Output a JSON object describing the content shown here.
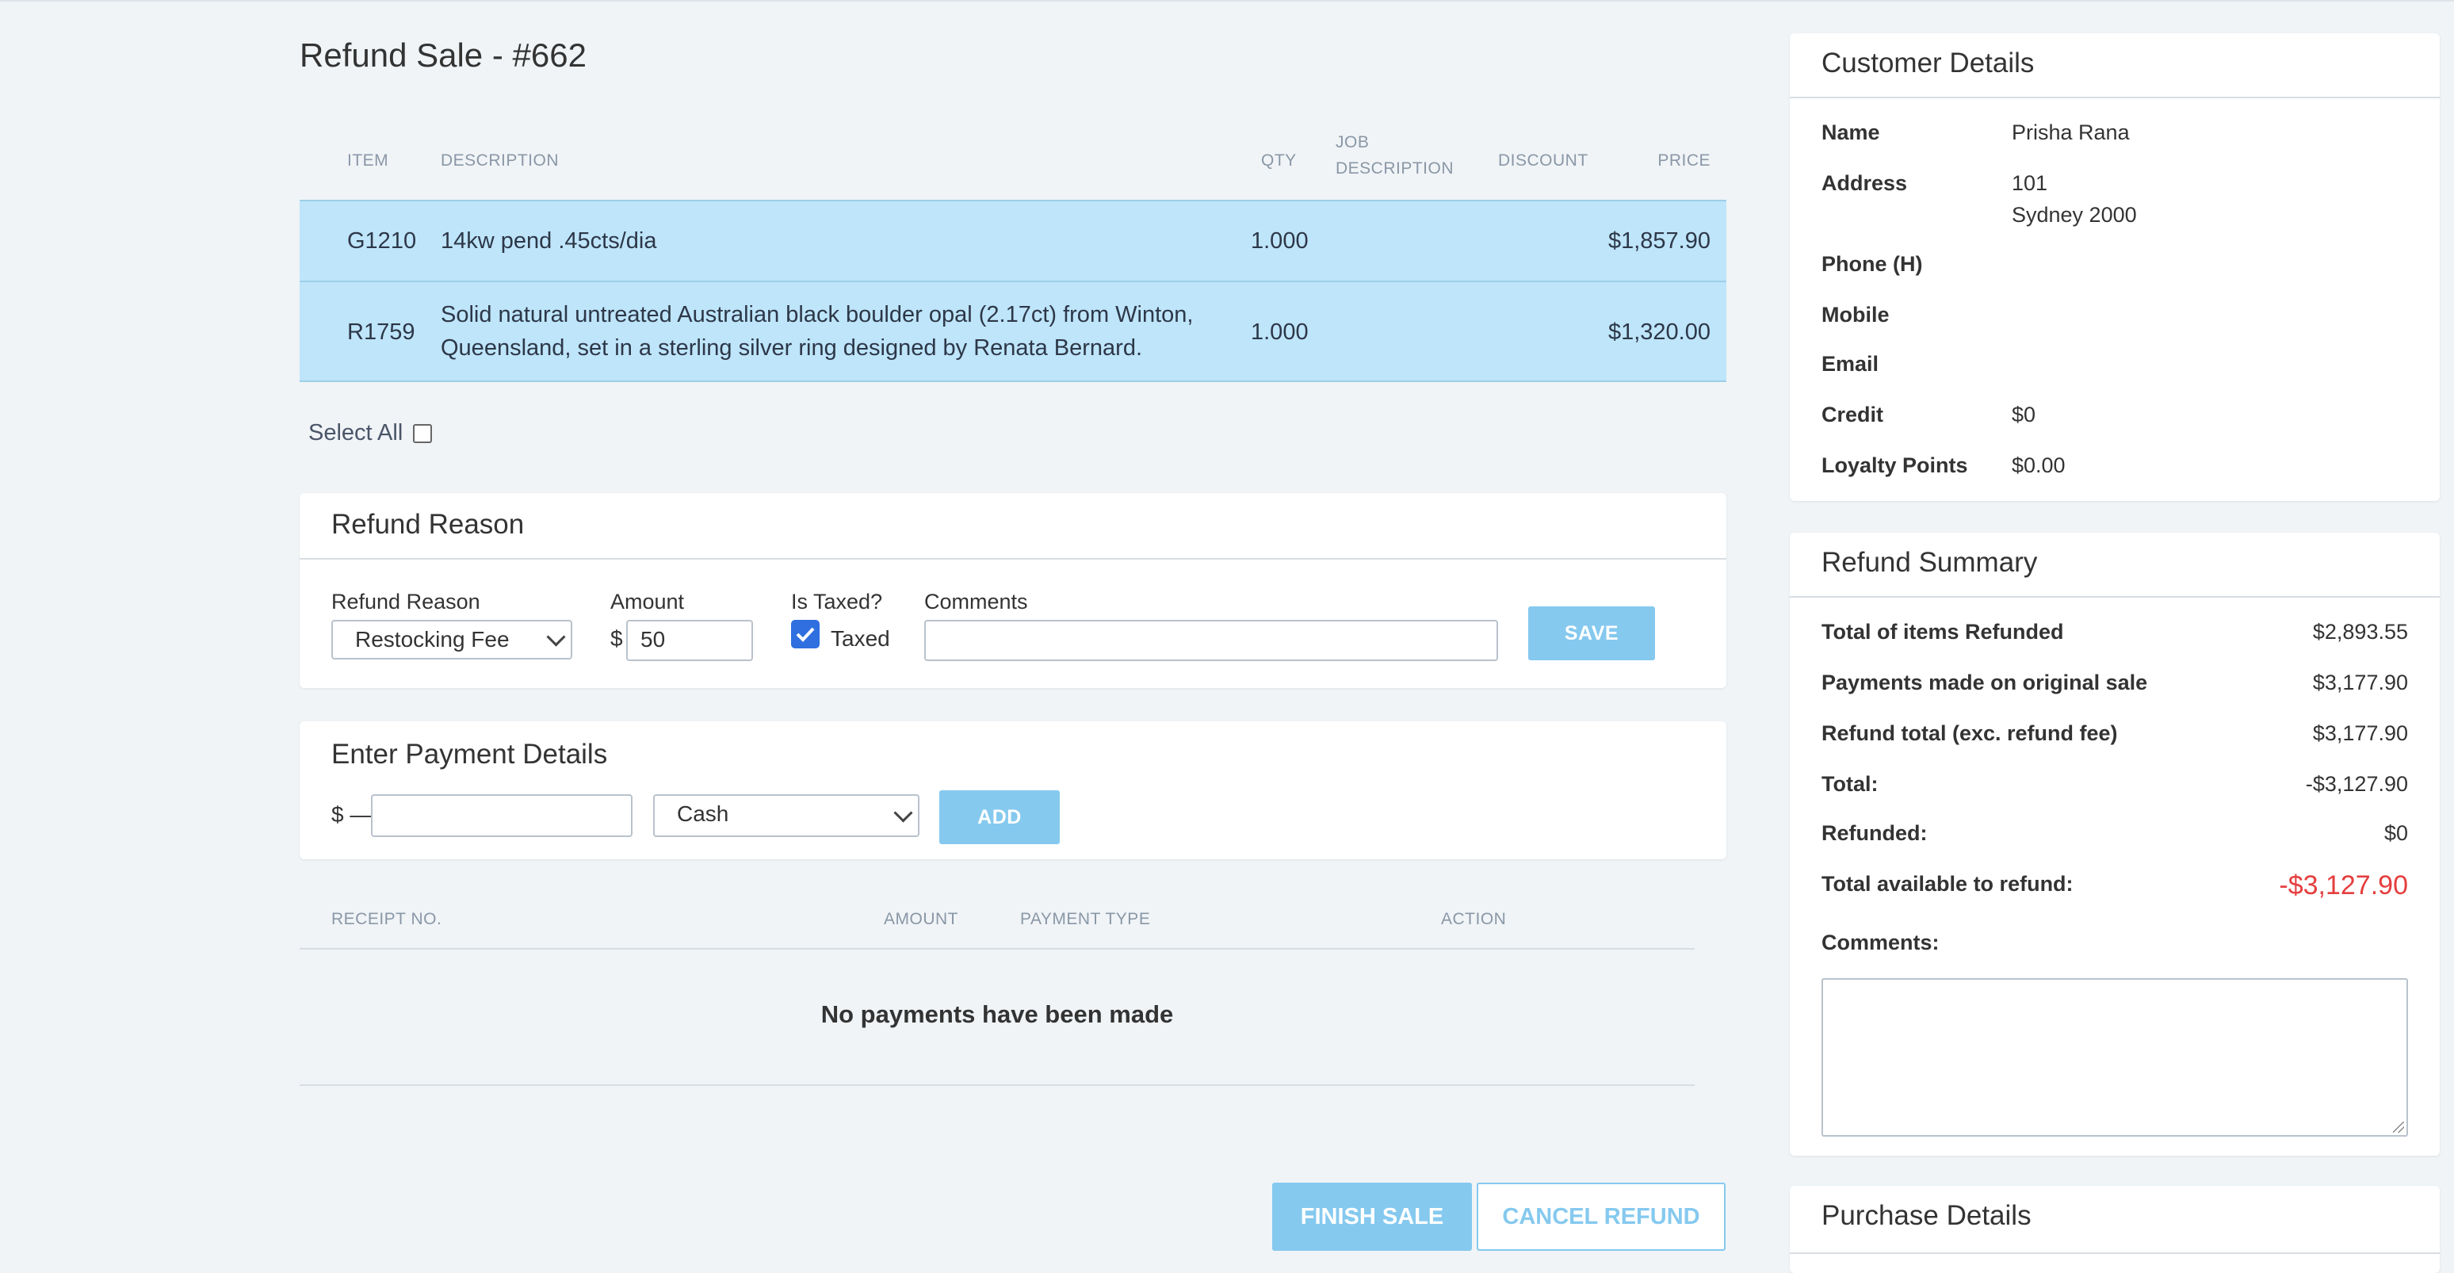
{
  "page": {
    "title": "Refund Sale - #662"
  },
  "items_table": {
    "headers": {
      "item": "ITEM",
      "description": "DESCRIPTION",
      "qty": "QTY",
      "job_description_line1": "JOB",
      "job_description_line2": "DESCRIPTION",
      "discount": "DISCOUNT",
      "price": "PRICE"
    },
    "rows": [
      {
        "item": "G1210",
        "description_line1": "14kw pend .45cts/dia",
        "description_line2": "",
        "qty": "1.000",
        "job_description": "",
        "discount": "",
        "price": "$1,857.90"
      },
      {
        "item": "R1759",
        "description_line1": "Solid natural untreated Australian black boulder opal (2.17ct) from Winton,",
        "description_line2": "Queensland, set in a sterling silver ring designed by Renata Bernard.",
        "qty": "1.000",
        "job_description": "",
        "discount": "",
        "price": "$1,320.00"
      }
    ]
  },
  "select_all": {
    "label": "Select All",
    "checked": false
  },
  "refund_reason_panel": {
    "title": "Refund Reason",
    "reason_label": "Refund Reason",
    "reason_value": "Restocking Fee",
    "amount_label": "Amount",
    "amount_prefix": "$",
    "amount_value": "50",
    "taxed_label": "Is Taxed?",
    "taxed_checkbox_label": "Taxed",
    "taxed_checked": true,
    "comments_label": "Comments",
    "comments_value": "",
    "save_label": "SAVE"
  },
  "payment_panel": {
    "title": "Enter Payment Details",
    "amount_prefix": "$ —",
    "amount_value": "",
    "method_value": "Cash",
    "add_label": "ADD"
  },
  "payments_table": {
    "headers": {
      "receipt": "RECEIPT NO.",
      "amount": "AMOUNT",
      "payment_type": "PAYMENT TYPE",
      "action": "ACTION"
    },
    "empty_message": "No payments have been made"
  },
  "actions": {
    "finish_label": "FINISH SALE",
    "cancel_label": "CANCEL REFUND"
  },
  "customer": {
    "title": "Customer Details",
    "name_label": "Name",
    "name_value": "Prisha Rana",
    "address_label": "Address",
    "address_line1": "101",
    "address_line2": "Sydney 2000",
    "phone_label": "Phone (H)",
    "phone_value": "",
    "mobile_label": "Mobile",
    "mobile_value": "",
    "email_label": "Email",
    "email_value": "",
    "credit_label": "Credit",
    "credit_value": "$0",
    "loyalty_label": "Loyalty Points",
    "loyalty_value": "$0.00"
  },
  "refund_summary": {
    "title": "Refund Summary",
    "total_items_label": "Total of items Refunded",
    "total_items_value": "$2,893.55",
    "payments_original_label": "Payments made on original sale",
    "payments_original_value": "$3,177.90",
    "refund_total_label": "Refund total (exc. refund fee)",
    "refund_total_value": "$3,177.90",
    "total_label": "Total:",
    "total_value": "-$3,127.90",
    "refunded_label": "Refunded:",
    "refunded_value": "$0",
    "available_label": "Total available to refund:",
    "available_value": "-$3,127.90",
    "comments_label": "Comments:",
    "comments_value": "",
    "accent_color": "#e53e3e"
  },
  "purchase_details": {
    "title": "Purchase Details"
  },
  "colors": {
    "row_highlight": "#bee5fa",
    "button": "#85c9ef",
    "background": "#f0f4f7"
  }
}
